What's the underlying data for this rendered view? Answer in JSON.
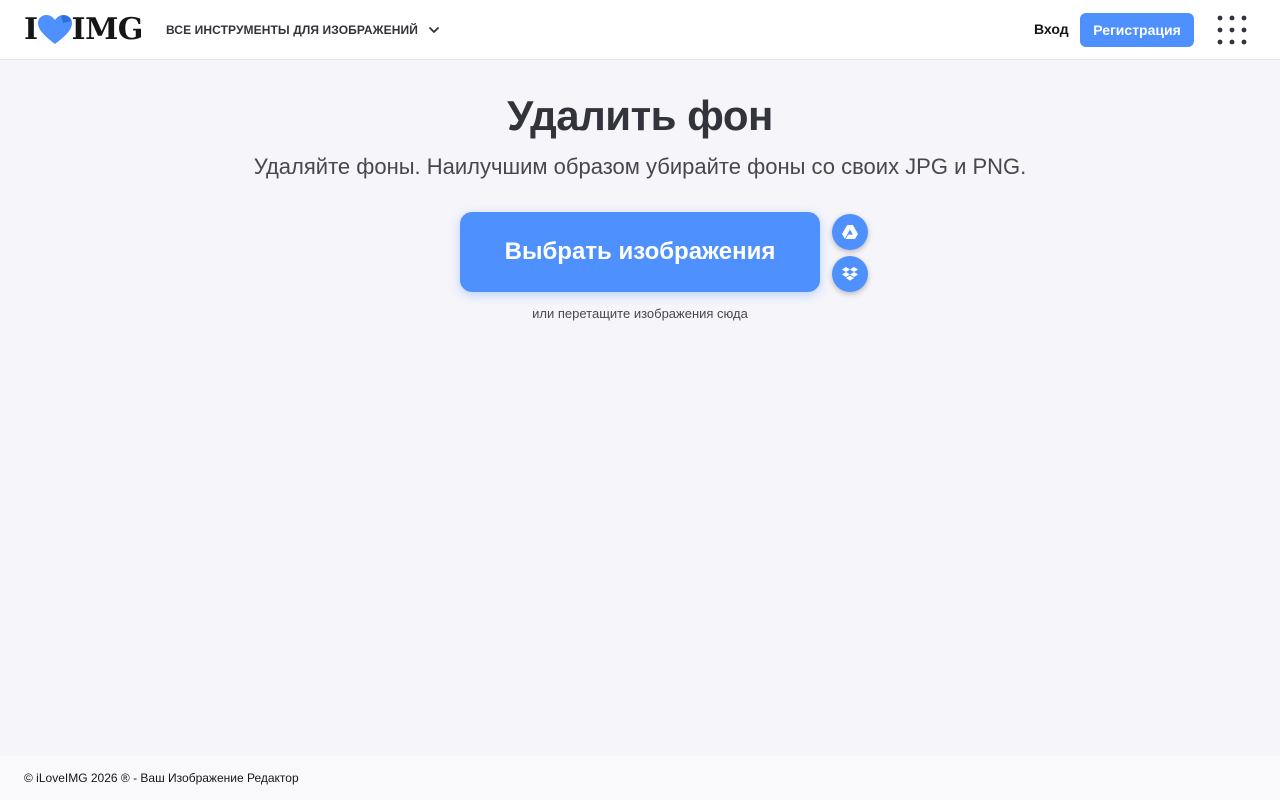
{
  "header": {
    "logo": {
      "prefix": "I",
      "suffix": "IMG",
      "icon": "heart-logo-icon"
    },
    "tools_menu_label": "ВСЕ ИНСТРУМЕНТЫ ДЛЯ ИЗОБРАЖЕНИЙ",
    "login_label": "Вход",
    "signup_label": "Регистрация",
    "apps_icon": "apps-grid-icon"
  },
  "main": {
    "title": "Удалить фон",
    "subtitle": "Удаляйте фоны. Наилучшим образом убирайте фоны со своих JPG и PNG.",
    "select_button_label": "Выбрать изображения",
    "cloud_buttons": [
      {
        "icon": "google-drive-icon"
      },
      {
        "icon": "dropbox-icon"
      }
    ],
    "drop_hint": "или перетащите изображения сюда"
  },
  "footer": {
    "text": "© iLoveIMG 2026 ® - Ваш Изображение Редактор"
  },
  "colors": {
    "accent": "#4d90fe",
    "background": "#f5f5fa",
    "header_bg": "#ffffff",
    "text": "#33333b"
  }
}
